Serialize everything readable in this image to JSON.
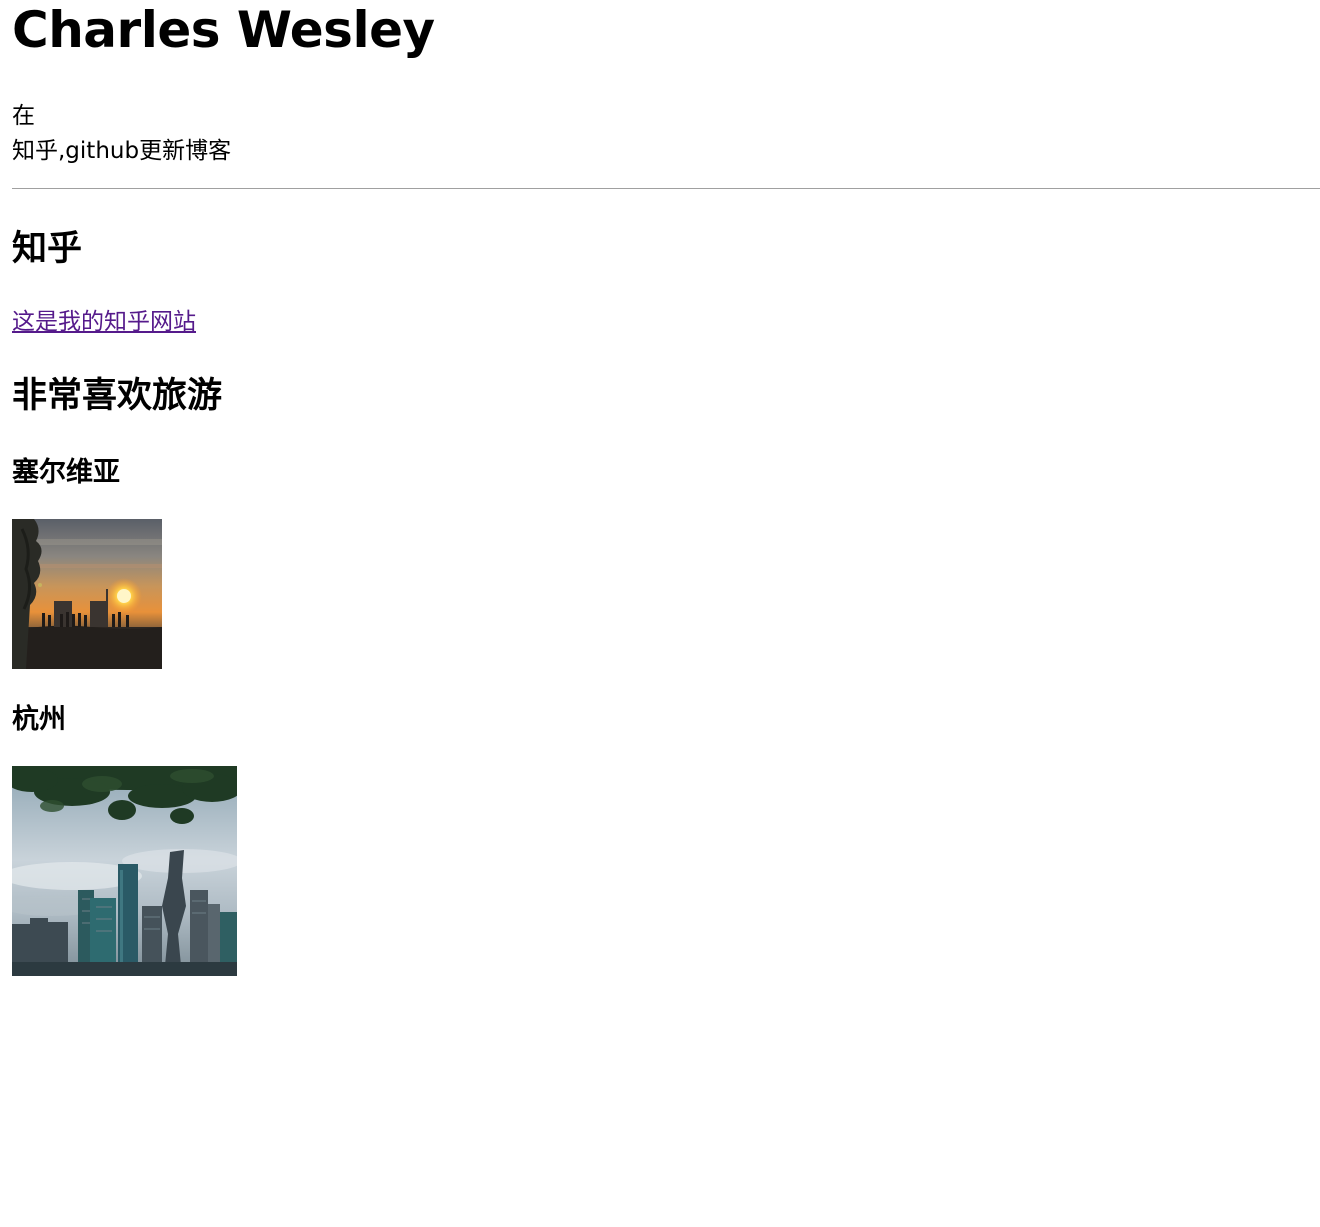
{
  "header": {
    "title": "Charles Wesley"
  },
  "intro": {
    "line1": "在",
    "line2": "知乎,github更新博客"
  },
  "zhihu": {
    "heading": "知乎",
    "link_text": "这是我的知乎网站"
  },
  "travel": {
    "heading": "非常喜欢旅游",
    "places": [
      {
        "name": "塞尔维亚",
        "photo": "sunset-photo"
      },
      {
        "name": "杭州",
        "photo": "city-skyline-photo"
      }
    ]
  },
  "colors": {
    "text": "#000000",
    "visited_link": "#551a8b",
    "divider": "#a0a0a0"
  }
}
